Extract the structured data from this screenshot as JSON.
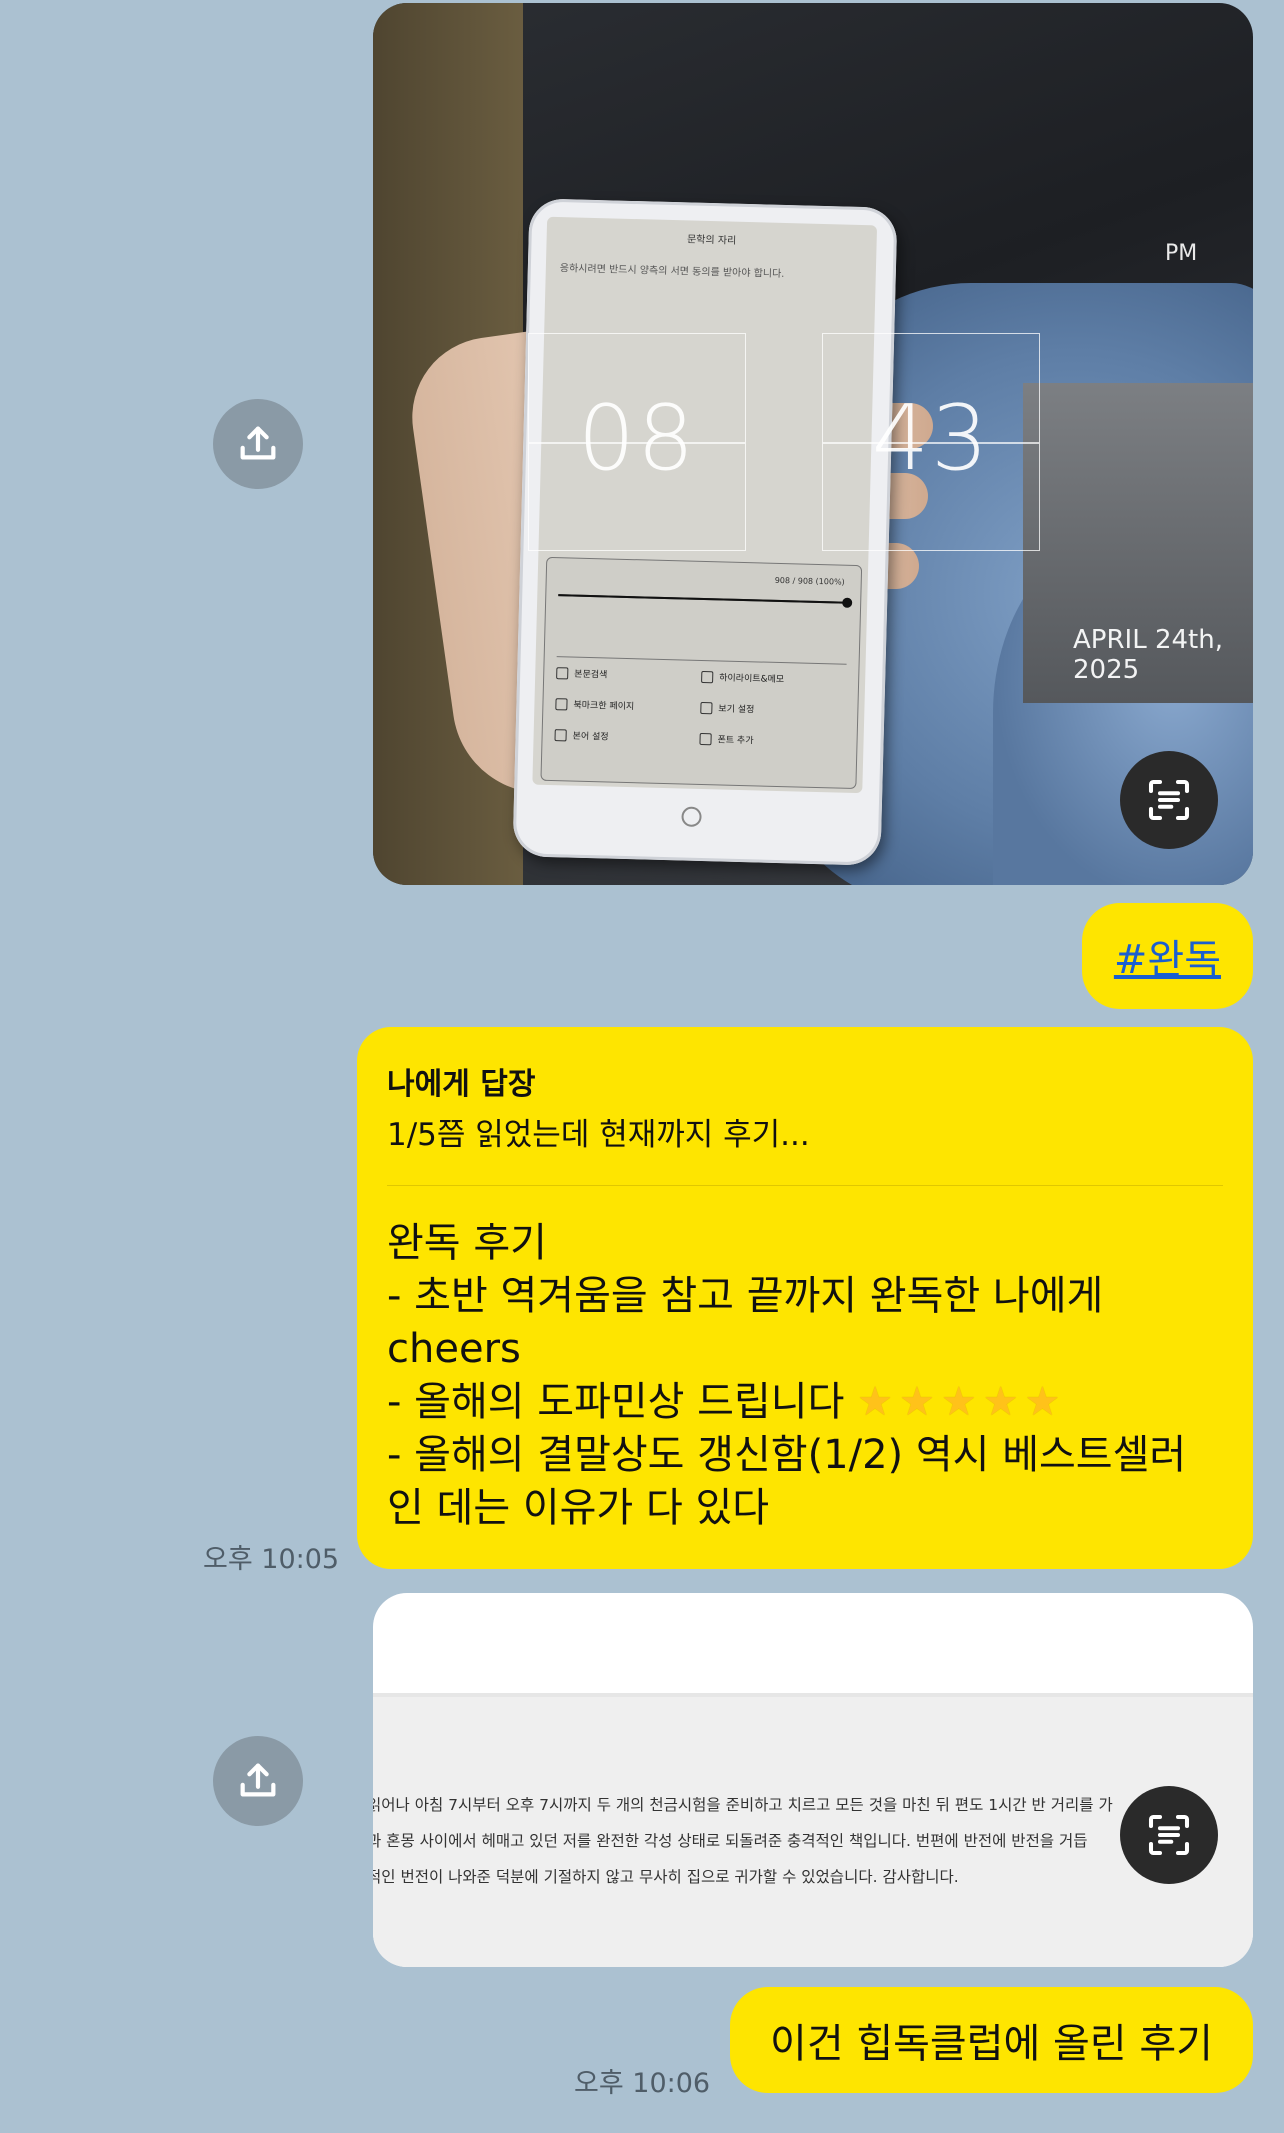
{
  "messages": {
    "photo1": {
      "reader_title": "문학의 자리",
      "reader_text": "응하시려면 반드시 양측의 서면 동의를 받아야 합니다.",
      "progress_label": "908 / 908 (100%)",
      "progress_fraction": 1.0,
      "menu": [
        "본문검색",
        "하이라이트&메모",
        "북마크한 페이지",
        "보기 설정",
        "본어 설정",
        "폰트 추가"
      ],
      "clock_hour": "08",
      "clock_minute": "43",
      "clock_ampm": "PM",
      "clock_date": "APRIL 24th, 2025"
    },
    "hashtag": "#완독",
    "reply": {
      "header": "나에게 답장",
      "quoted": "1/5쯤 읽었는데 현재까지 후기...",
      "lines": [
        "완독 후기",
        "- 초반 역겨움을 참고 끝까지 완독한 나에게",
        "cheers",
        "- 올해의 도파민상 드립니다",
        "- 올해의 결말상도 갱신함(1/2) 역시 베스트셀러",
        "인 데는 이유가 다 있다"
      ],
      "stars": "★★★★★",
      "time": "오후 10:05"
    },
    "screenshot2": {
      "lines": [
        "읽어나 아침 7시부터 오후 7시까지 두 개의 천금시험을 준비하고 치르고 모든 것을 마친 뒤 편도 1시간 반 거리를 가",
        "과 혼몽 사이에서 헤매고 있던 저를 완전한 각성 상태로 되돌려준 충격적인 책입니다. 번편에 반전에 반전을 거듭",
        "적인 번전이 나와준 덕분에 기절하지 않고 무사히 집으로 귀가할 수 있었습니다. 감사합니다."
      ]
    },
    "last": {
      "text": "이건 힙독클럽에 올린 후기",
      "time": "오후 10:06"
    }
  },
  "icons": {
    "share": "share-upload-icon",
    "ocr": "text-scan-icon"
  },
  "colors": {
    "background": "#abc1d1",
    "bubble": "#fee500",
    "link": "#1a5fd0"
  }
}
